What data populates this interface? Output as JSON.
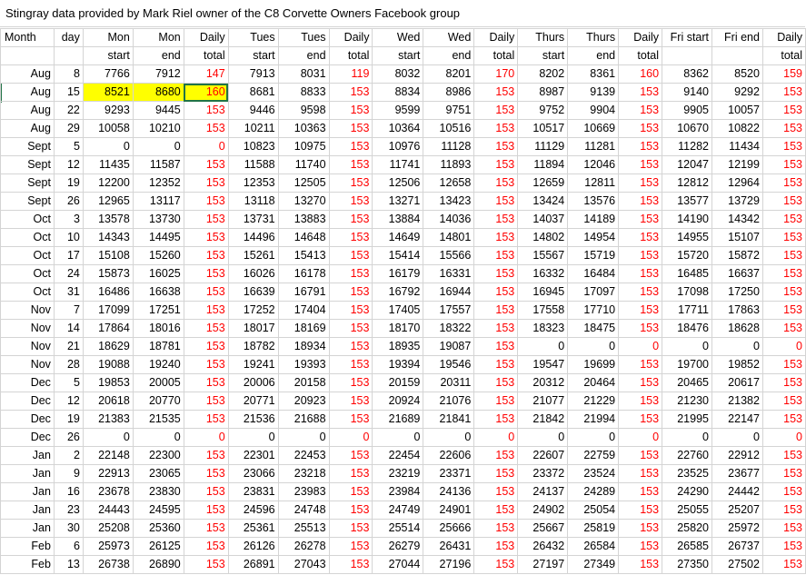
{
  "title": "Stingray data provided by Mark Riel owner of the C8 Corvette Owners Facebook group",
  "header_row1": [
    "Month",
    "day",
    "Mon",
    "Mon",
    "Daily",
    "Tues",
    "Tues",
    "Daily",
    "Wed",
    "Wed",
    "Daily",
    "Thurs",
    "Thurs",
    "Daily",
    "Fri start",
    "Fri end",
    "Daily"
  ],
  "header_row2": [
    "",
    "",
    "start",
    "end",
    "total",
    "start",
    "end",
    "total",
    "start",
    "end",
    "total",
    "start",
    "end",
    "total",
    "",
    "",
    "total"
  ],
  "rows": [
    [
      "Aug",
      "8",
      "7766",
      "7912",
      "147",
      "7913",
      "8031",
      "119",
      "8032",
      "8201",
      "170",
      "8202",
      "8361",
      "160",
      "8362",
      "8520",
      "159"
    ],
    [
      "Aug",
      "15",
      "8521",
      "8680",
      "160",
      "8681",
      "8833",
      "153",
      "8834",
      "8986",
      "153",
      "8987",
      "9139",
      "153",
      "9140",
      "9292",
      "153"
    ],
    [
      "Aug",
      "22",
      "9293",
      "9445",
      "153",
      "9446",
      "9598",
      "153",
      "9599",
      "9751",
      "153",
      "9752",
      "9904",
      "153",
      "9905",
      "10057",
      "153"
    ],
    [
      "Aug",
      "29",
      "10058",
      "10210",
      "153",
      "10211",
      "10363",
      "153",
      "10364",
      "10516",
      "153",
      "10517",
      "10669",
      "153",
      "10670",
      "10822",
      "153"
    ],
    [
      "Sept",
      "5",
      "0",
      "0",
      "0",
      "10823",
      "10975",
      "153",
      "10976",
      "11128",
      "153",
      "11129",
      "11281",
      "153",
      "11282",
      "11434",
      "153"
    ],
    [
      "Sept",
      "12",
      "11435",
      "11587",
      "153",
      "11588",
      "11740",
      "153",
      "11741",
      "11893",
      "153",
      "11894",
      "12046",
      "153",
      "12047",
      "12199",
      "153"
    ],
    [
      "Sept",
      "19",
      "12200",
      "12352",
      "153",
      "12353",
      "12505",
      "153",
      "12506",
      "12658",
      "153",
      "12659",
      "12811",
      "153",
      "12812",
      "12964",
      "153"
    ],
    [
      "Sept",
      "26",
      "12965",
      "13117",
      "153",
      "13118",
      "13270",
      "153",
      "13271",
      "13423",
      "153",
      "13424",
      "13576",
      "153",
      "13577",
      "13729",
      "153"
    ],
    [
      "Oct",
      "3",
      "13578",
      "13730",
      "153",
      "13731",
      "13883",
      "153",
      "13884",
      "14036",
      "153",
      "14037",
      "14189",
      "153",
      "14190",
      "14342",
      "153"
    ],
    [
      "Oct",
      "10",
      "14343",
      "14495",
      "153",
      "14496",
      "14648",
      "153",
      "14649",
      "14801",
      "153",
      "14802",
      "14954",
      "153",
      "14955",
      "15107",
      "153"
    ],
    [
      "Oct",
      "17",
      "15108",
      "15260",
      "153",
      "15261",
      "15413",
      "153",
      "15414",
      "15566",
      "153",
      "15567",
      "15719",
      "153",
      "15720",
      "15872",
      "153"
    ],
    [
      "Oct",
      "24",
      "15873",
      "16025",
      "153",
      "16026",
      "16178",
      "153",
      "16179",
      "16331",
      "153",
      "16332",
      "16484",
      "153",
      "16485",
      "16637",
      "153"
    ],
    [
      "Oct",
      "31",
      "16486",
      "16638",
      "153",
      "16639",
      "16791",
      "153",
      "16792",
      "16944",
      "153",
      "16945",
      "17097",
      "153",
      "17098",
      "17250",
      "153"
    ],
    [
      "Nov",
      "7",
      "17099",
      "17251",
      "153",
      "17252",
      "17404",
      "153",
      "17405",
      "17557",
      "153",
      "17558",
      "17710",
      "153",
      "17711",
      "17863",
      "153"
    ],
    [
      "Nov",
      "14",
      "17864",
      "18016",
      "153",
      "18017",
      "18169",
      "153",
      "18170",
      "18322",
      "153",
      "18323",
      "18475",
      "153",
      "18476",
      "18628",
      "153"
    ],
    [
      "Nov",
      "21",
      "18629",
      "18781",
      "153",
      "18782",
      "18934",
      "153",
      "18935",
      "19087",
      "153",
      "0",
      "0",
      "0",
      "0",
      "0",
      "0"
    ],
    [
      "Nov",
      "28",
      "19088",
      "19240",
      "153",
      "19241",
      "19393",
      "153",
      "19394",
      "19546",
      "153",
      "19547",
      "19699",
      "153",
      "19700",
      "19852",
      "153"
    ],
    [
      "Dec",
      "5",
      "19853",
      "20005",
      "153",
      "20006",
      "20158",
      "153",
      "20159",
      "20311",
      "153",
      "20312",
      "20464",
      "153",
      "20465",
      "20617",
      "153"
    ],
    [
      "Dec",
      "12",
      "20618",
      "20770",
      "153",
      "20771",
      "20923",
      "153",
      "20924",
      "21076",
      "153",
      "21077",
      "21229",
      "153",
      "21230",
      "21382",
      "153"
    ],
    [
      "Dec",
      "19",
      "21383",
      "21535",
      "153",
      "21536",
      "21688",
      "153",
      "21689",
      "21841",
      "153",
      "21842",
      "21994",
      "153",
      "21995",
      "22147",
      "153"
    ],
    [
      "Dec",
      "26",
      "0",
      "0",
      "0",
      "0",
      "0",
      "0",
      "0",
      "0",
      "0",
      "0",
      "0",
      "0",
      "0",
      "0",
      "0"
    ],
    [
      "Jan",
      "2",
      "22148",
      "22300",
      "153",
      "22301",
      "22453",
      "153",
      "22454",
      "22606",
      "153",
      "22607",
      "22759",
      "153",
      "22760",
      "22912",
      "153"
    ],
    [
      "Jan",
      "9",
      "22913",
      "23065",
      "153",
      "23066",
      "23218",
      "153",
      "23219",
      "23371",
      "153",
      "23372",
      "23524",
      "153",
      "23525",
      "23677",
      "153"
    ],
    [
      "Jan",
      "16",
      "23678",
      "23830",
      "153",
      "23831",
      "23983",
      "153",
      "23984",
      "24136",
      "153",
      "24137",
      "24289",
      "153",
      "24290",
      "24442",
      "153"
    ],
    [
      "Jan",
      "23",
      "24443",
      "24595",
      "153",
      "24596",
      "24748",
      "153",
      "24749",
      "24901",
      "153",
      "24902",
      "25054",
      "153",
      "25055",
      "25207",
      "153"
    ],
    [
      "Jan",
      "30",
      "25208",
      "25360",
      "153",
      "25361",
      "25513",
      "153",
      "25514",
      "25666",
      "153",
      "25667",
      "25819",
      "153",
      "25820",
      "25972",
      "153"
    ],
    [
      "Feb",
      "6",
      "25973",
      "26125",
      "153",
      "26126",
      "26278",
      "153",
      "26279",
      "26431",
      "153",
      "26432",
      "26584",
      "153",
      "26585",
      "26737",
      "153"
    ],
    [
      "Feb",
      "13",
      "26738",
      "26890",
      "153",
      "26891",
      "27043",
      "153",
      "27044",
      "27196",
      "153",
      "27197",
      "27349",
      "153",
      "27350",
      "27502",
      "153"
    ]
  ],
  "daily_total_columns": [
    4,
    7,
    10,
    13,
    16
  ],
  "highlighted_row_index": 1,
  "highlighted_columns": [
    2,
    3,
    4
  ],
  "selected_cell": {
    "row": 1,
    "col": 4
  },
  "colors": {
    "daily_total": "#ff0000",
    "highlight": "#ffff00",
    "selection": "#217346",
    "gridline": "#d4d4d4"
  }
}
